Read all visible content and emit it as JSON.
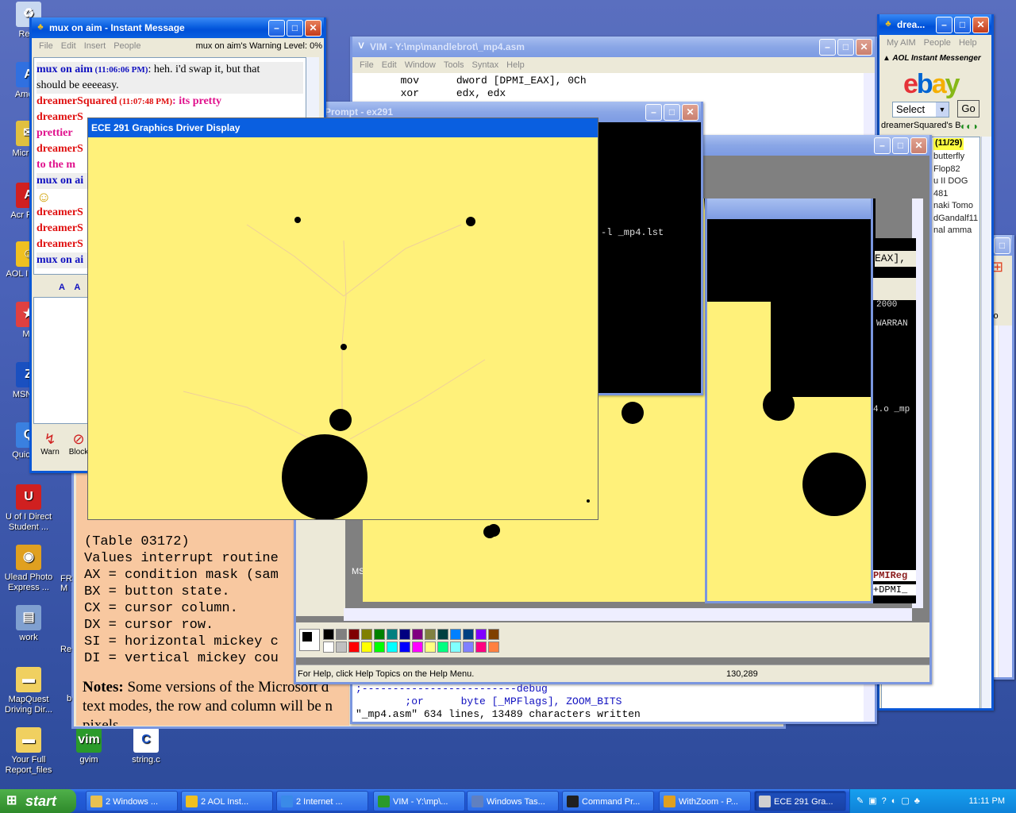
{
  "desktop": {
    "icons": [
      {
        "label": "Recy",
        "glyph": "♻"
      },
      {
        "label": "Americ",
        "glyph": "A"
      },
      {
        "label": "Micr Oul",
        "glyph": "✉"
      },
      {
        "label": "Acr Reac",
        "glyph": "A"
      },
      {
        "label": "AOL I Mess",
        "glyph": "☺"
      },
      {
        "label": "Mo",
        "glyph": "★"
      },
      {
        "label": "MSN Zo",
        "glyph": "Z"
      },
      {
        "label": "Quic Pla",
        "glyph": "Q"
      },
      {
        "label": "U of I Direct Student ...",
        "glyph": "U"
      },
      {
        "label": "Ulead Photo Express ...",
        "glyph": "◉"
      },
      {
        "label": "work",
        "glyph": "▤"
      },
      {
        "label": "MapQuest Driving Dir...",
        "glyph": "▬"
      },
      {
        "label": "Your Full Report_files",
        "glyph": "▬"
      },
      {
        "label": "gvim",
        "glyph": "vim"
      },
      {
        "label": "string.c",
        "glyph": "C"
      }
    ]
  },
  "im_window": {
    "title": "mux on aim - Instant Message",
    "menu": [
      "File",
      "Edit",
      "Insert",
      "People"
    ],
    "warning": "mux on aim's Warning Level: 0%",
    "messages": [
      {
        "name": "mux on aim",
        "time": "(11:06:06 PM)",
        "text": "heh.  i'd swap it, but that",
        "style": "blue"
      },
      {
        "name": "",
        "time": "",
        "text": "should be eeeeasy.",
        "style": "blue-cont"
      },
      {
        "name": "dreamerSquared",
        "time": "(11:07:48 PM)",
        "text": "its pretty",
        "style": "red"
      },
      {
        "name": "dreamerS",
        "time": "",
        "text": "",
        "style": "red"
      },
      {
        "name": "",
        "time": "",
        "text": "prettier",
        "style": "pink"
      },
      {
        "name": "dreamerS",
        "time": "",
        "text": "",
        "style": "red"
      },
      {
        "name": "",
        "time": "",
        "text": "to the m",
        "style": "pink"
      },
      {
        "name": "mux on ai",
        "time": "",
        "text": "",
        "style": "blue"
      },
      {
        "name": "",
        "time": "",
        "text": "☺",
        "style": "smiley"
      },
      {
        "name": "dreamerS",
        "time": "",
        "text": "",
        "style": "red"
      },
      {
        "name": "dreamerS",
        "time": "",
        "text": "",
        "style": "red"
      },
      {
        "name": "dreamerS",
        "time": "",
        "text": "",
        "style": "red"
      },
      {
        "name": "mux on ai",
        "time": "",
        "text": "",
        "style": "blue"
      }
    ],
    "warn_label": "Warn",
    "block_label": "Block"
  },
  "vim_window": {
    "title": "VIM - Y:\\mp\\mandlebrot\\_mp4.asm",
    "menu": [
      "File",
      "Edit",
      "Window",
      "Tools",
      "Syntax",
      "Help"
    ],
    "lines": [
      {
        "op": "mov",
        "arg": "dword [DPMI_EAX], 0Ch"
      },
      {
        "op": "xor",
        "arg": "edx, edx"
      }
    ],
    "bottom_lines": [
      ";-------------------------debug",
      "        ;or      byte [_MPFlags], ZOOM_BITS",
      "\"_mp4.asm\" 634 lines, 13489 characters written"
    ]
  },
  "cmd_window": {
    "title": "Prompt - ex291",
    "line": "-l _mp4.lst"
  },
  "aim_buddy": {
    "title": "drea...",
    "menu": [
      "My AIM",
      "People",
      "Help"
    ],
    "brand": "AOL Instant Messenger",
    "select": "Select",
    "go": "Go",
    "screen_name": "dreamerSquared's B",
    "group": "(11/29)",
    "buddies": [
      "butterfly",
      "Flop82",
      "u II DOG",
      "481",
      "naki Tomo",
      "dGandalf11",
      "nal amma"
    ]
  },
  "paint_window": {
    "status_help": "For Help, click Help Topics on the Help Menu.",
    "status_coords": "130,289",
    "palette_top": [
      "#000000",
      "#808080",
      "#800000",
      "#808000",
      "#008000",
      "#008080",
      "#000080",
      "#800080",
      "#808040",
      "#004040",
      "#0080ff",
      "#004080",
      "#8000ff",
      "#804000"
    ],
    "palette_bottom": [
      "#ffffff",
      "#c0c0c0",
      "#ff0000",
      "#ffff00",
      "#00ff00",
      "#00ffff",
      "#0000ff",
      "#ff00ff",
      "#ffff80",
      "#00ff80",
      "#80ffff",
      "#8080ff",
      "#ff0080",
      "#ff8040"
    ]
  },
  "mid_window": {
    "title_frag": "sm",
    "text1": "EAX],",
    "text2": "2000",
    "text3": "WARRAN",
    "text4": "4.o _mp",
    "text5": "PMIReg",
    "text6": "+DPMI_"
  },
  "ie_window": {
    "go": "Go"
  },
  "ece_window": {
    "title": "ECE 291 Graphics Driver Display"
  },
  "doc_window": {
    "lines": [
      "(Table 03172)",
      "Values interrupt routine",
      "AX = condition mask (sam",
      "BX = button state.",
      "CX = cursor column.",
      "DX = cursor row.",
      "SI = horizontal mickey c",
      "DI = vertical mickey cou"
    ],
    "notes_bold": "Notes:",
    "notes_text": "Some versions of the Microsoft d",
    "notes_text2": "text modes, the row and column will be n",
    "notes_text3": "pixels",
    "side_a": "MSI",
    "side_b": "FR M",
    "side_c": "Re",
    "side_d": "b"
  },
  "taskbar": {
    "start": "start",
    "buttons": [
      {
        "label": "2 Windows ...",
        "color": "#e8c050"
      },
      {
        "label": "2 AOL Inst...",
        "color": "#f0c020"
      },
      {
        "label": "2 Internet ...",
        "color": "#3a8ae8"
      },
      {
        "label": "VIM - Y:\\mp\\...",
        "color": "#2a9a2a"
      },
      {
        "label": "Windows Tas...",
        "color": "#6080c0"
      },
      {
        "label": "Command Pr...",
        "color": "#202020"
      },
      {
        "label": "WithZoom - P...",
        "color": "#e0a020"
      },
      {
        "label": "ECE 291 Gra...",
        "color": "#d0d0d0"
      }
    ],
    "clock": "11:11 PM"
  }
}
